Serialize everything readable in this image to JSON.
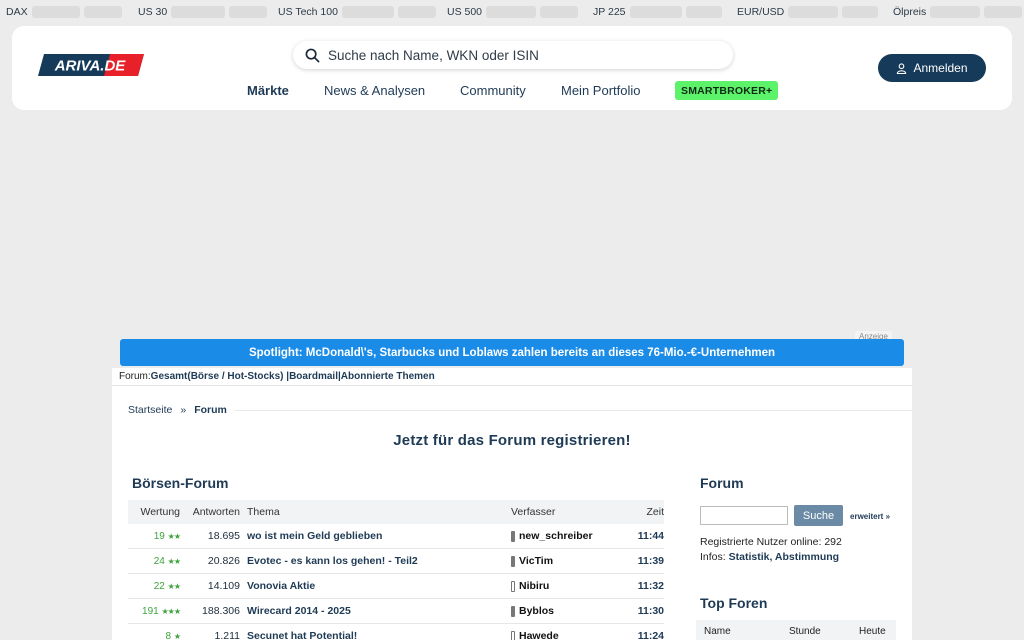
{
  "ticker": [
    {
      "label": "DAX"
    },
    {
      "label": "US 30"
    },
    {
      "label": "US Tech 100"
    },
    {
      "label": "US 500"
    },
    {
      "label": "JP 225"
    },
    {
      "label": "EUR/USD"
    },
    {
      "label": "Ölpreis"
    }
  ],
  "header": {
    "logo": "ARIVA.DE",
    "search_placeholder": "Suche nach Name, WKN oder ISIN",
    "nav": [
      "Märkte",
      "News & Analysen",
      "Community",
      "Mein Portfolio"
    ],
    "smartbroker": "SMARTBROKER+",
    "login": "Anmelden"
  },
  "ad": {
    "label": "Anzeige",
    "spotlight": "Spotlight: McDonald\\'s, Starbucks und Loblaws zahlen bereits an dieses 76-Mio.-€-Unternehmen"
  },
  "forumbar": {
    "prefix": "Forum: ",
    "gesamt": "Gesamt",
    "open": " ( ",
    "boerse": "Börse / Hot-Stocks",
    "close": " ) | ",
    "boardmail": "Boardmail",
    "sep": " | ",
    "abonniert": "Abonnierte Themen"
  },
  "breadcrumb": {
    "home": "Startseite",
    "sep": "»",
    "current": "Forum"
  },
  "register_text": "Jetzt für das Forum registrieren!",
  "boersen_forum": {
    "title": "Börsen-Forum",
    "columns": [
      "Wertung",
      "Antworten",
      "Thema",
      "Verfasser",
      "Zeit"
    ],
    "rows": [
      {
        "rating": "19",
        "stars": "★★",
        "answers": "18.695",
        "topic": "wo ist mein Geld geblieben",
        "author": "new_schreiber",
        "time": "11:44"
      },
      {
        "rating": "24",
        "stars": "★★",
        "answers": "20.826",
        "topic": "Evotec - es kann los gehen! - Teil2",
        "author": "VicTim",
        "time": "11:39"
      },
      {
        "rating": "22",
        "stars": "★★",
        "answers": "14.109",
        "topic": "Vonovia Aktie",
        "author": "Nibiru",
        "time": "11:32"
      },
      {
        "rating": "191",
        "stars": "★★★",
        "answers": "188.306",
        "topic": "Wirecard 2014 - 2025",
        "author": "Byblos",
        "time": "11:30"
      },
      {
        "rating": "8",
        "stars": "★",
        "answers": "1.211",
        "topic": "Secunet hat Potential!",
        "author": "Hawede",
        "time": "11:24"
      }
    ]
  },
  "side": {
    "title": "Forum",
    "search_button": "Suche",
    "extended": "erweitert »",
    "online_label": "Registrierte Nutzer online: ",
    "online_count": "292",
    "infos_label": "Infos: ",
    "infos_links": "Statistik, Abstimmung",
    "top_title": "Top Foren",
    "top_columns": [
      "Name",
      "Stunde",
      "Heute"
    ]
  },
  "colors": {
    "brand": "#163a5a",
    "link": "#1e3a55",
    "spotlight": "#1a8ce8",
    "smartbroker": "#5cf26a",
    "rating": "#3ea23e"
  }
}
